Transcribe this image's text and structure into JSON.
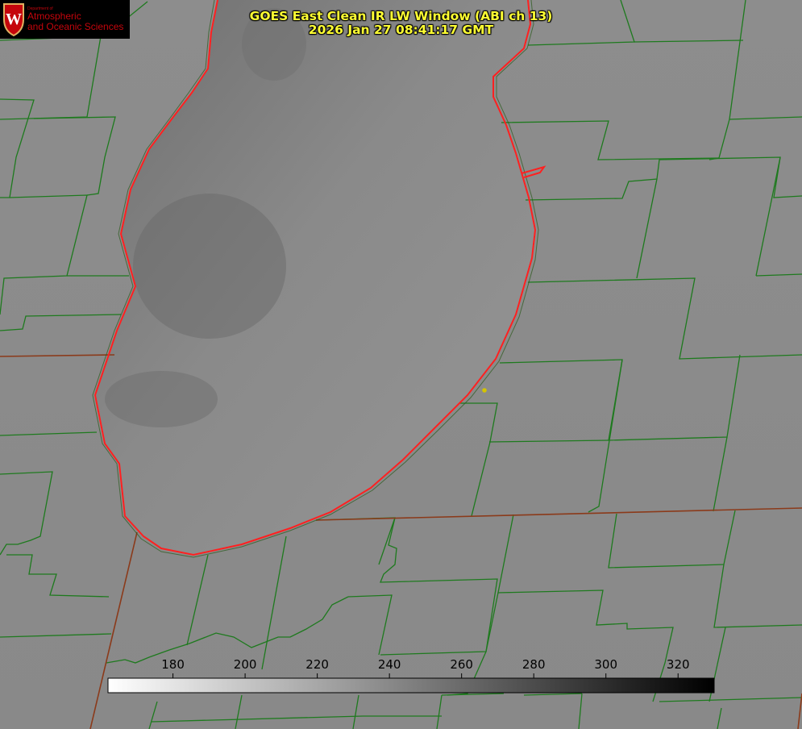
{
  "header": {
    "title_line1": "GOES East Clean IR LW Window (ABI ch 13)",
    "title_line2": "2026 Jan 27 08:41:17 GMT"
  },
  "logo": {
    "dept_label": "Department of",
    "line1": "Atmospheric",
    "line2": "and Oceanic Sciences",
    "emblem": "uw-crest-icon"
  },
  "colorbar": {
    "ticks": [
      {
        "label": "180",
        "value": 180
      },
      {
        "label": "200",
        "value": 200
      },
      {
        "label": "220",
        "value": 220
      },
      {
        "label": "240",
        "value": 240
      },
      {
        "label": "260",
        "value": 260
      },
      {
        "label": "280",
        "value": 280
      },
      {
        "label": "300",
        "value": 300
      },
      {
        "label": "320",
        "value": 320
      }
    ],
    "range": [
      162,
      330
    ],
    "gradient": "white-to-black"
  },
  "colors": {
    "title": "#ffff33",
    "lake_outline": "#ff2020",
    "county_lines": "#1e7a1e",
    "state_lines": "#8b3a1a",
    "city_marker": "#d4c400",
    "logo_text": "#c5050c"
  }
}
